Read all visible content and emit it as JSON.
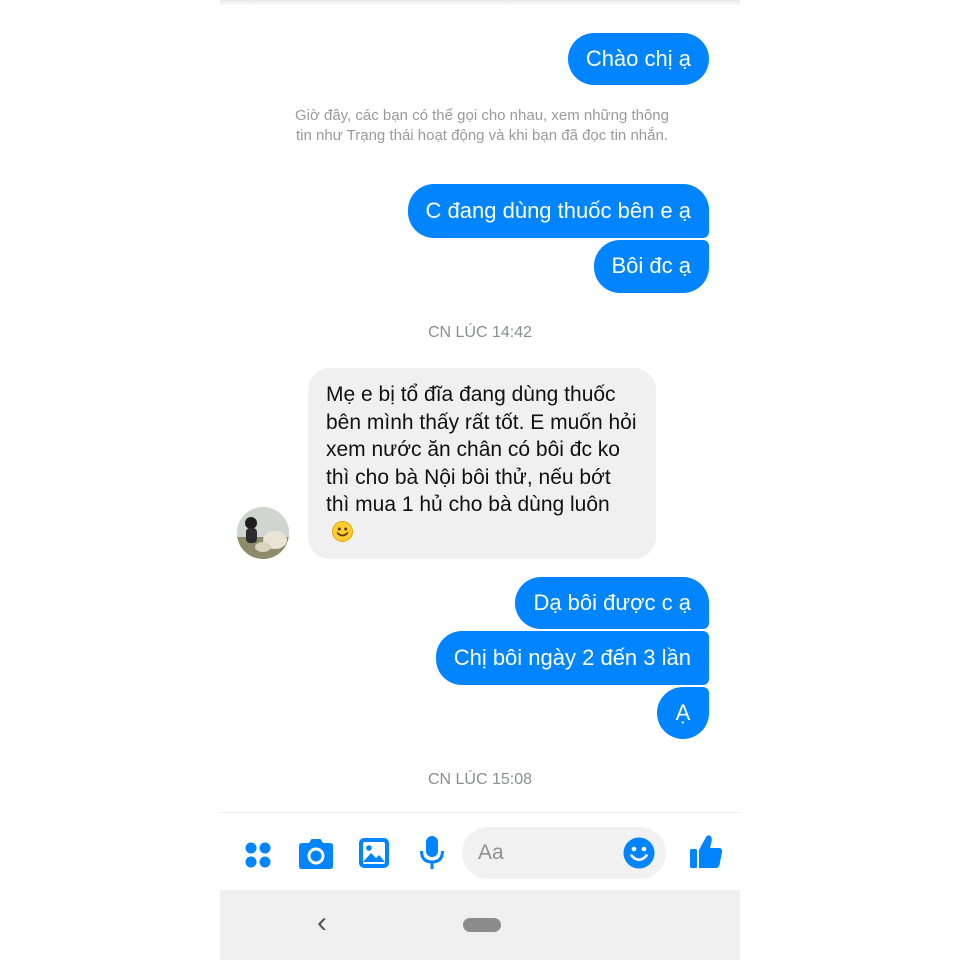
{
  "conversation": {
    "messages": [
      {
        "id": "m1",
        "dir": "out",
        "text": "Chào chị ạ"
      },
      {
        "id": "m2",
        "dir": "out",
        "text": "C đang dùng thuốc bên e ạ"
      },
      {
        "id": "m3",
        "dir": "out",
        "text": "Bôi đc ạ"
      },
      {
        "id": "m4",
        "dir": "in",
        "text": "Mẹ e bị tổ đĩa đang dùng thuốc bên mình thấy rất tốt. E muốn hỏi xem nước ăn chân có bôi đc ko thì cho bà Nội bôi thử, nếu bớt thì mua 1 hủ cho bà dùng luôn"
      },
      {
        "id": "m5",
        "dir": "out",
        "text": "Dạ bôi được c ạ"
      },
      {
        "id": "m6",
        "dir": "out",
        "text": "Chị bôi ngày 2 đến 3 lần"
      },
      {
        "id": "m7",
        "dir": "out",
        "text": "Ạ"
      }
    ],
    "info_notice": "Giờ đây, các bạn có thể gọi cho nhau, xem những thông tin như Trạng thái hoạt động và khi bạn đã đọc tin nhắn.",
    "timestamps": [
      "CN LÚC 14:42",
      "CN LÚC 15:08"
    ]
  },
  "composer": {
    "placeholder": "Aa",
    "icons": [
      "apps-icon",
      "camera-icon",
      "gallery-icon",
      "microphone-icon",
      "emoji-icon",
      "thumbs-up-icon"
    ],
    "accent_color": "#0084ff"
  },
  "navbar": {
    "back_glyph": "‹",
    "icons": [
      "back-icon",
      "home-pill-icon"
    ]
  },
  "colors": {
    "outgoing_bubble": "#0084ff",
    "incoming_bubble": "#f1f0f0",
    "timestamp_text": "#8a8d91"
  }
}
